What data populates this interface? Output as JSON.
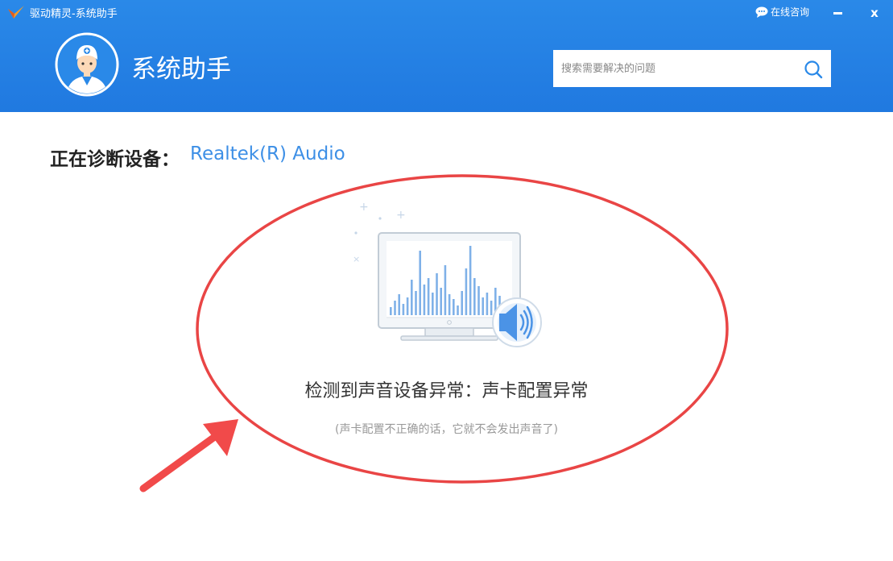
{
  "window": {
    "app_title": "驱动精灵-系统助手",
    "consult_label": "在线咨询",
    "minimize_icon": "minimize-icon",
    "close_label": "x"
  },
  "header": {
    "page_title": "系统助手",
    "search": {
      "placeholder": "搜索需要解决的问题",
      "value": ""
    }
  },
  "diagnosis": {
    "label": "正在诊断设备：",
    "device": "Realtek(R) Audio"
  },
  "result": {
    "title": "检测到声音设备异常：声卡配置异常",
    "subtitle": "(声卡配置不正确的话，它就不会发出声音了)"
  },
  "colors": {
    "header_blue": "#2a89e8",
    "accent_blue": "#3d8fe6",
    "annotation_red": "#e94545"
  }
}
